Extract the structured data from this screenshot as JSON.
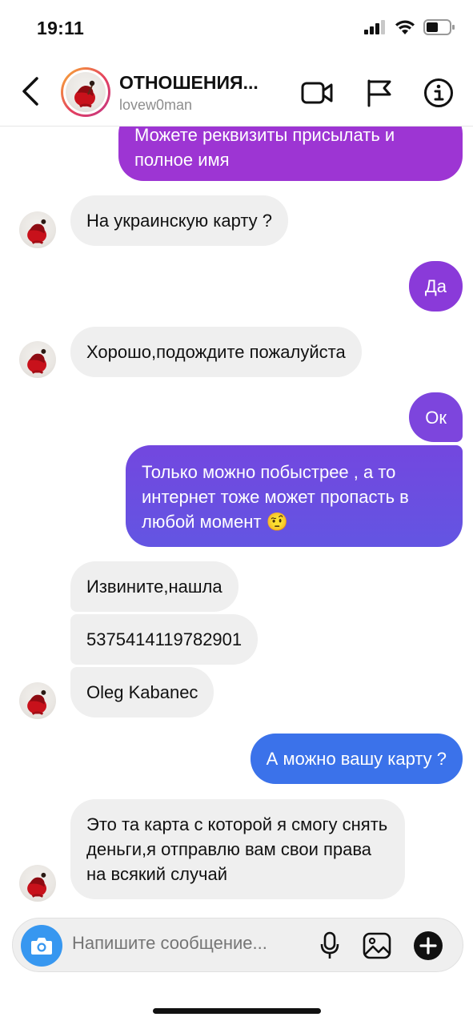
{
  "status_bar": {
    "time": "19:11"
  },
  "header": {
    "name": "ОТНОШЕНИЯ...",
    "username": "lovew0man",
    "icons": [
      "back-chevron-icon",
      "video-camera-icon",
      "flag-icon",
      "info-icon"
    ]
  },
  "messages": [
    {
      "side": "out",
      "text": "Можете реквизиты присылать и полное имя"
    },
    {
      "side": "in",
      "text": "На украинскую карту ?"
    },
    {
      "side": "out",
      "text": "Да"
    },
    {
      "side": "in",
      "text": "Хорошо,подождите пожалуйста"
    },
    {
      "side": "out",
      "text": "Ок"
    },
    {
      "side": "out",
      "text": "Только можно побыстрее , а то интернет тоже может пропасть в любой момент 🤨"
    },
    {
      "side": "in",
      "text": "Извините,нашла"
    },
    {
      "side": "in",
      "text": "5375414119782901"
    },
    {
      "side": "in",
      "text": "Oleg Kabanec"
    },
    {
      "side": "out",
      "text": "А можно вашу карту ?"
    },
    {
      "side": "in",
      "text": "Это та карта с которой я смогу снять деньги,я отправлю вам свои права на всякий случай"
    }
  ],
  "composer": {
    "placeholder": "Напишите сообщение...",
    "icons": [
      "camera-icon",
      "microphone-icon",
      "gallery-icon",
      "plus-icon"
    ]
  },
  "colors": {
    "accent_blue": "#3797f0",
    "bubble_incoming": "#efefef",
    "bubble_purple": "#8f34d8",
    "bubble_violet": "#6c4de0",
    "bubble_blue": "#3b72ea"
  }
}
